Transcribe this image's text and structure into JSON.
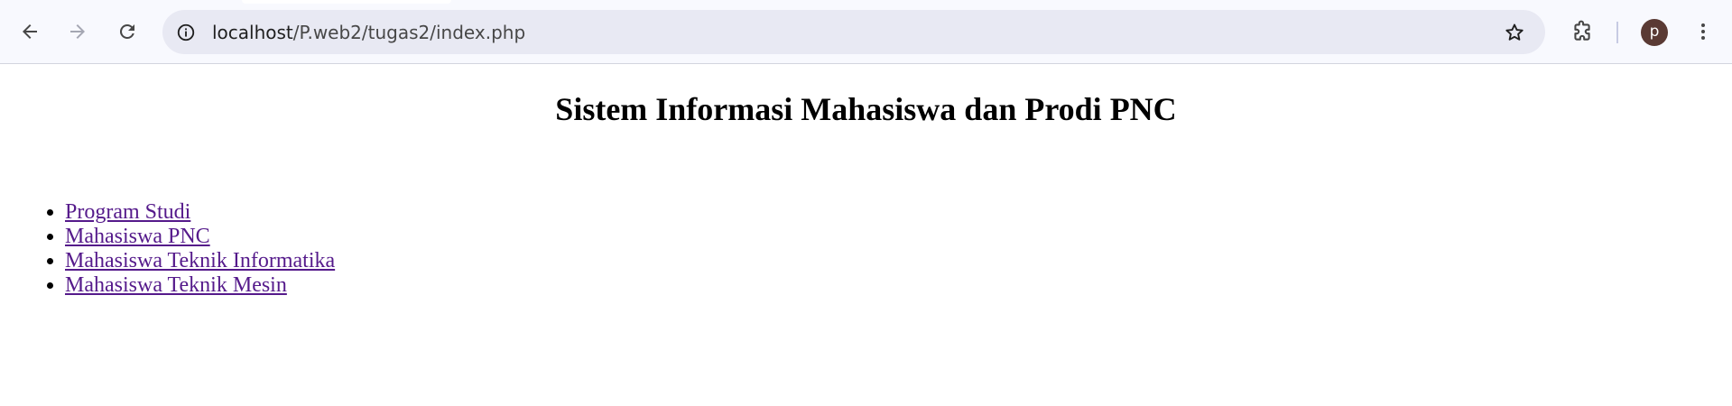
{
  "browser": {
    "url_host": "localhost",
    "url_path": "/P.web2/tugas2/index.php",
    "profile_initial": "p",
    "icons": {
      "back": "arrow-left-icon",
      "forward": "arrow-right-icon",
      "reload": "reload-icon",
      "site_info": "info-icon",
      "bookmark": "star-icon",
      "extensions": "puzzle-icon",
      "menu": "kebab-menu-icon"
    },
    "colors": {
      "toolbar_bg": "#f8f9fe",
      "omnibox_bg": "#e8e9f3",
      "avatar_bg": "#5a3a34"
    }
  },
  "page": {
    "title": "Sistem Informasi Mahasiswa dan Prodi PNC",
    "links": [
      {
        "label": "Program Studi"
      },
      {
        "label": "Mahasiswa PNC"
      },
      {
        "label": "Mahasiswa Teknik Informatika"
      },
      {
        "label": "Mahasiswa Teknik Mesin"
      }
    ],
    "colors": {
      "visited_link": "#551a8b"
    }
  }
}
